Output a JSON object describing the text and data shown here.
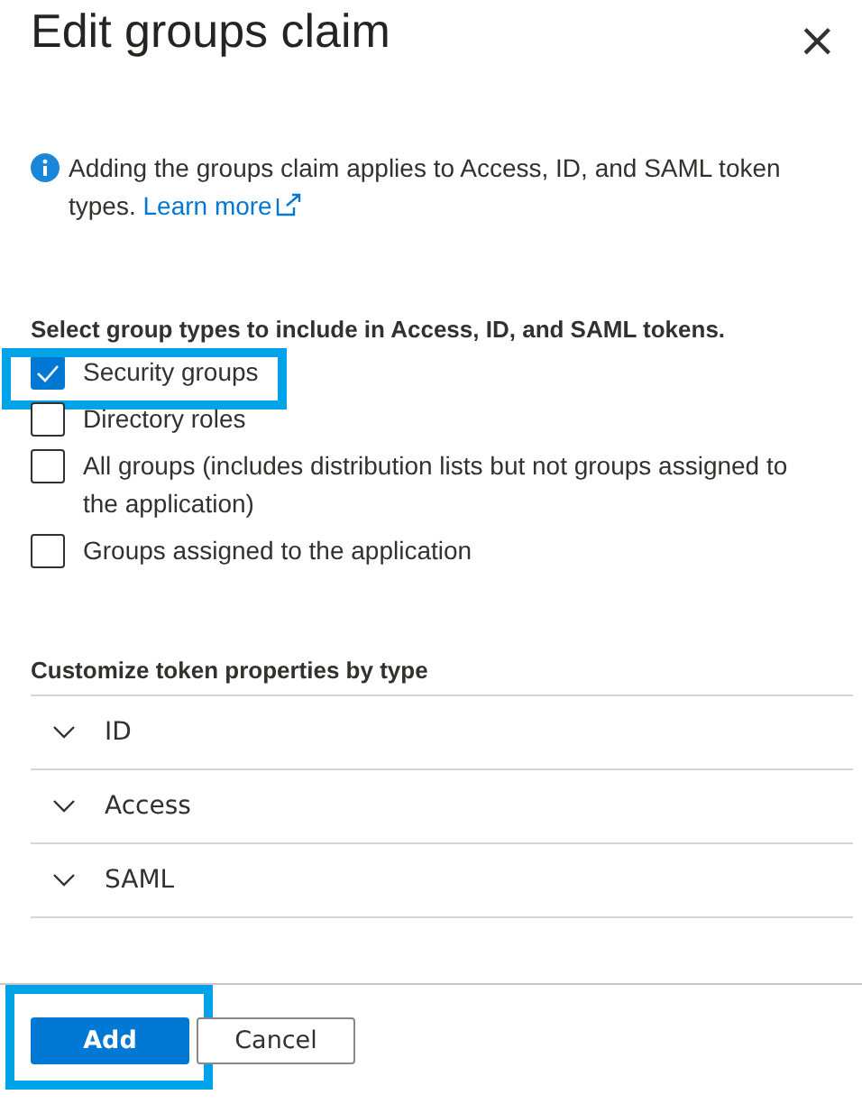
{
  "panel": {
    "title": "Edit groups claim",
    "close": "×"
  },
  "info": {
    "text": "Adding the groups claim applies to Access, ID, and SAML token types.",
    "link": "Learn more"
  },
  "group_types": {
    "heading": "Select group types to include in Access, ID, and SAML tokens.",
    "options": [
      {
        "label": "Security groups",
        "checked": true,
        "highlighted": true
      },
      {
        "label": "Directory roles",
        "checked": false,
        "highlighted": false
      },
      {
        "label": "All groups (includes distribution lists but not groups assigned to the application)",
        "checked": false,
        "highlighted": false
      },
      {
        "label": "Groups assigned to the application",
        "checked": false,
        "highlighted": false
      }
    ]
  },
  "token_properties": {
    "heading": "Customize token properties by type",
    "sections": [
      {
        "label": "ID",
        "expanded": false
      },
      {
        "label": "Access",
        "expanded": false
      },
      {
        "label": "SAML",
        "expanded": false
      }
    ]
  },
  "buttons": [
    {
      "label": "Add",
      "kind": "primary",
      "highlighted": true
    },
    {
      "label": "Cancel",
      "kind": "secondary",
      "highlighted": false
    }
  ]
}
